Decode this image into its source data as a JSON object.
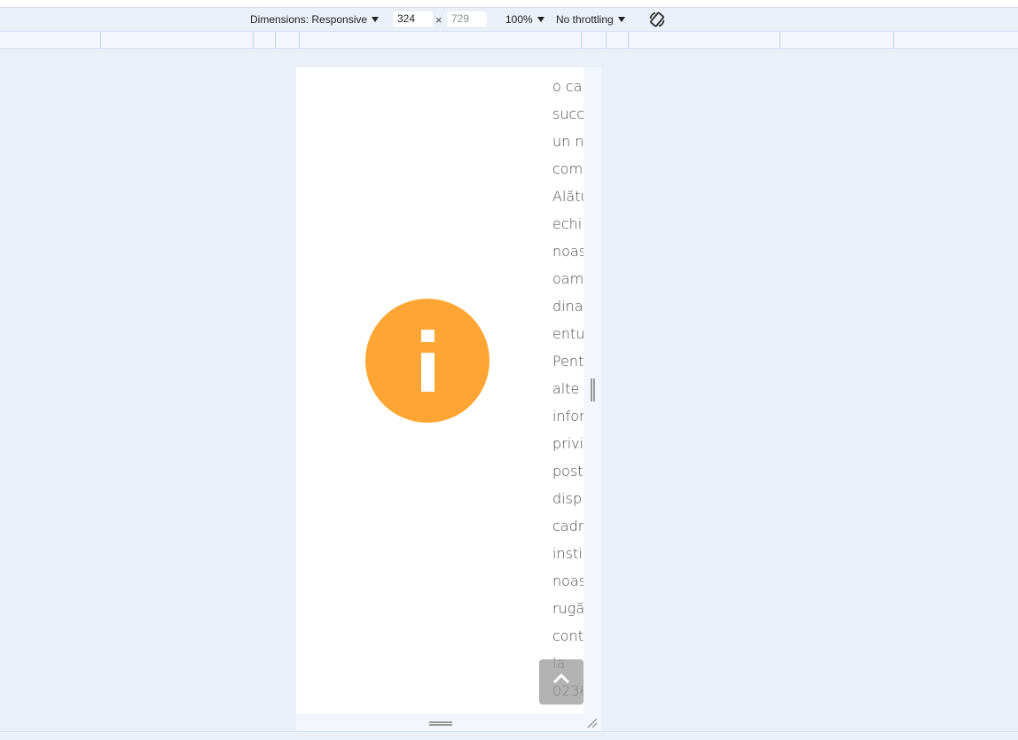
{
  "toolbar": {
    "dimensions_label": "Dimensions: Responsive",
    "width_value": "324",
    "height_value": "729",
    "times_symbol": "×",
    "zoom_label": "100%",
    "throttling_label": "No throttling",
    "rotate_icon": "rotate-icon"
  },
  "page": {
    "info_icon": "info-icon",
    "info_color": "#ffa533",
    "text_fragments": [
      "o ca",
      "succ",
      "un n",
      "com",
      "Alătu",
      "echi",
      "noas",
      "oam",
      "dina",
      "entu",
      "Pent",
      "alte",
      "infor",
      "privi",
      "post",
      "disp",
      "cadr",
      "insti",
      "noas",
      "rugă",
      "cont",
      "la",
      "0236",
      "..."
    ],
    "scroll_top_icon": "chevron-up-icon"
  },
  "colors": {
    "background": "#ebf0f8",
    "viewport": "#ffffff",
    "accent": "#ffa533"
  }
}
